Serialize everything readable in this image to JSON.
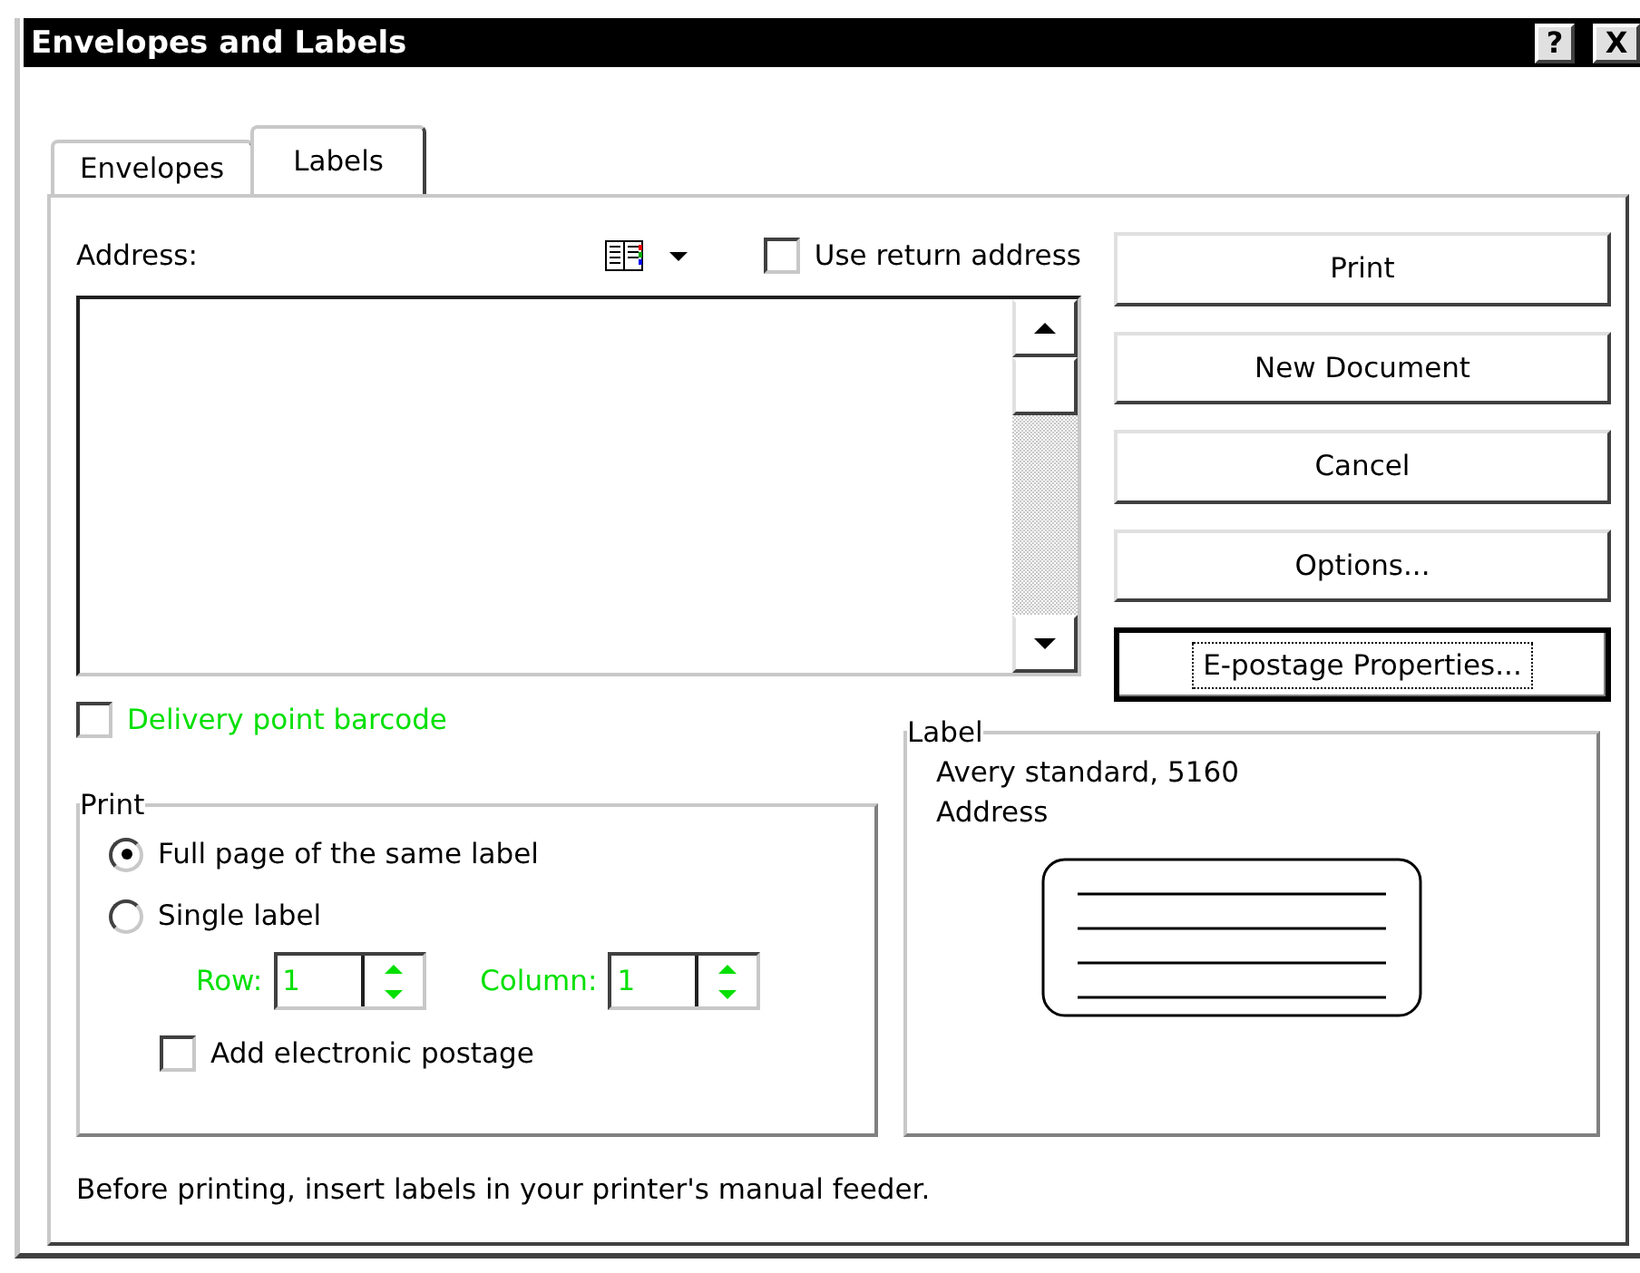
{
  "window": {
    "title": "Envelopes and Labels",
    "buttons": [
      {
        "kind": "help",
        "label": "?"
      },
      {
        "kind": "close",
        "label": "X"
      }
    ]
  },
  "tabs": [
    {
      "label": "Envelopes",
      "selected": false
    },
    {
      "label": "Labels",
      "selected": true
    }
  ],
  "address": {
    "label": "Address:"
  },
  "use_return_address": {
    "label": "Use return address",
    "checked": false
  },
  "delivery_point_barcode": {
    "label": "Delivery point barcode",
    "checked": false,
    "highlighted": true
  },
  "buttons": [
    {
      "label": "Print",
      "focused": false
    },
    {
      "label": "New Document",
      "focused": false
    },
    {
      "label": "Cancel",
      "focused": false
    },
    {
      "label": "Options...",
      "focused": false
    },
    {
      "label": "E-postage Properties...",
      "focused": true
    }
  ],
  "print_group": {
    "title": "Print",
    "options": [
      {
        "label": "Full page of the same label",
        "selected": true
      },
      {
        "label": "Single label",
        "selected": false
      }
    ],
    "row": {
      "label": "Row:",
      "value": "1",
      "highlighted": true
    },
    "column": {
      "label": "Column:",
      "value": "1",
      "highlighted": true
    },
    "add_electronic_postage": {
      "label": "Add electronic postage",
      "checked": false
    }
  },
  "label_group": {
    "title": "Label",
    "lines": [
      "Avery standard, 5160",
      "Address"
    ]
  },
  "footer": "Before printing, insert labels in your printer's manual feeder."
}
